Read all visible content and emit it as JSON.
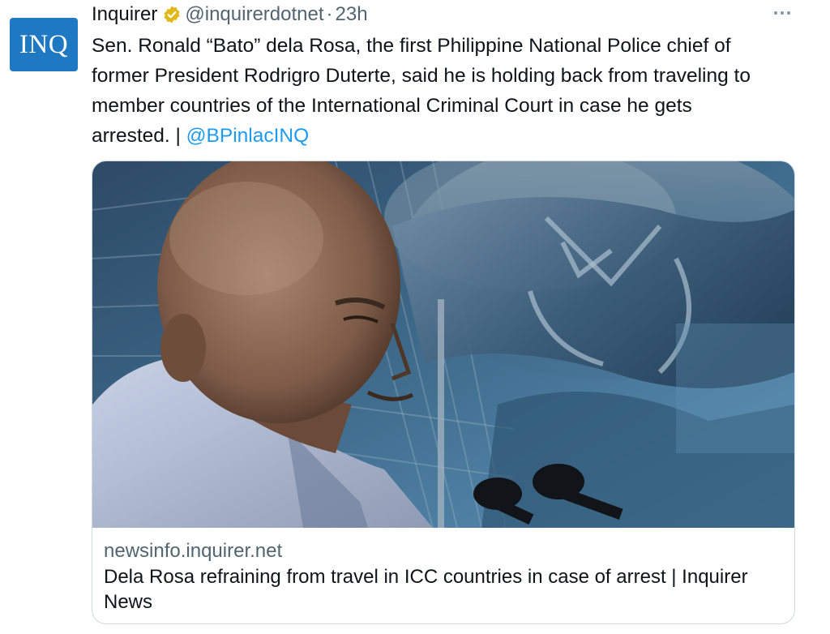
{
  "tweet": {
    "display_name": "Inquirer",
    "handle": "@inquirerdotnet",
    "separator": "·",
    "time": "23h",
    "avatar_text": "INQ",
    "body_lines": [
      "Sen. Ronald “Bato” dela Rosa, the first Philippine National Police chief of",
      "former President Rodrigro Duterte, said he is holding back from traveling to",
      "member countries of the International Criminal Court in case he gets"
    ],
    "body_last_line_prefix": "arrested. | ",
    "mention": "@BPinlacINQ",
    "icons": {
      "verified": "verified-badge-icon",
      "more": "more-options-icon"
    },
    "colors": {
      "link": "#1d9bf0",
      "secondary_text": "#536471",
      "verified_gold": "#e2b719",
      "avatar_bg": "#1f78c2"
    }
  },
  "card": {
    "domain": "newsinfo.inquirer.net",
    "title": "Dela Rosa refraining from travel in ICC countries in case of arrest | Inquirer News",
    "image_icon": "news-photo"
  }
}
